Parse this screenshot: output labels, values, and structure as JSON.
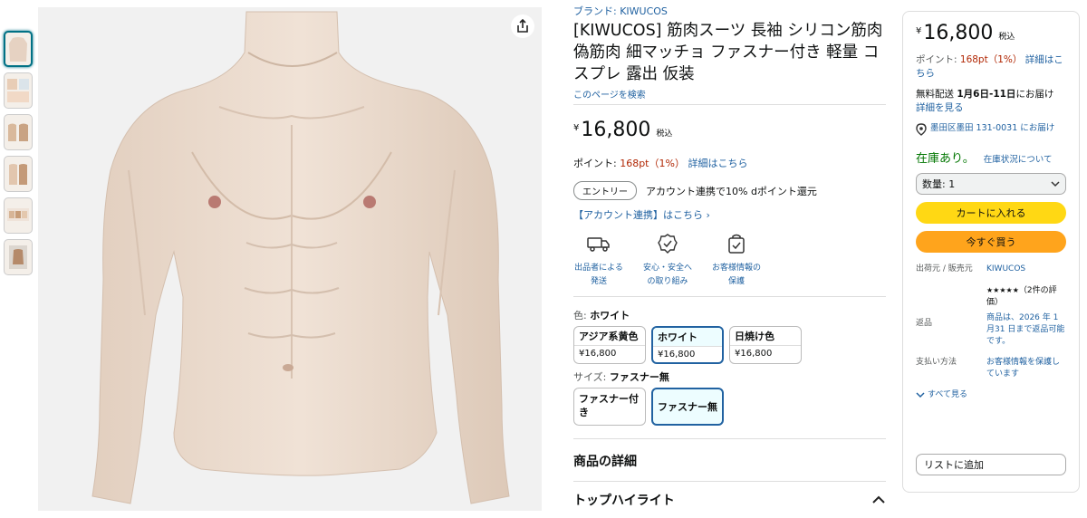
{
  "product": {
    "brand": "ブランド: KIWUCOS",
    "title": "[KIWUCOS] 筋肉スーツ 長袖 シリコン筋肉 偽筋肉 細マッチョ ファスナー付き 軽量 コスプレ 露出 仮装",
    "search_this_page": "このページを検索"
  },
  "price": {
    "yen": "¥",
    "amount": "16,800",
    "tax": "税込",
    "points_label": "ポイント: ",
    "points_value": "168pt（1%）",
    "points_link": "詳細はこちら"
  },
  "entry": {
    "button": "エントリー",
    "text": "アカウント連携で10% dポイント還元",
    "link": "【アカウント連携】はこちら ›"
  },
  "features": [
    {
      "icon": "truck-icon",
      "label": "出品者による発送"
    },
    {
      "icon": "badge-icon",
      "label": "安心・安全への取り組み"
    },
    {
      "icon": "shield-check-icon",
      "label": "お客様情報の保護"
    }
  ],
  "color": {
    "label": "色: ",
    "selected": "ホワイト",
    "options": [
      {
        "name": "アジア系黄色",
        "price": "¥16,800",
        "selected": false
      },
      {
        "name": "ホワイト",
        "price": "¥16,800",
        "selected": true
      },
      {
        "name": "日焼け色",
        "price": "¥16,800",
        "selected": false
      }
    ]
  },
  "size": {
    "label": "サイズ: ",
    "selected": "ファスナー無",
    "options": [
      {
        "name": "ファスナー付き",
        "selected": false
      },
      {
        "name": "ファスナー無",
        "selected": true
      }
    ]
  },
  "sections": {
    "details": "商品の詳細",
    "highlights": "トップハイライト"
  },
  "buybox": {
    "yen": "¥",
    "amount": "16,800",
    "tax": "税込",
    "points_label": "ポイント: ",
    "points_value": "168pt（1%）",
    "points_link": "詳細はこちら",
    "delivery_prefix": "無料配送 ",
    "delivery_date": "1月6日-11日",
    "delivery_suffix": "にお届け",
    "delivery_link": "詳細を見る",
    "location": "墨田区墨田 131-0031 にお届け",
    "stock": "在庫あり。",
    "stock_link": "在庫状況について",
    "quantity": "数量: 1",
    "cart_button": "カートに入れる",
    "buy_button": "今すぐ買う",
    "seller_label": "出荷元 / 販売元",
    "seller_value": "KIWUCOS",
    "rating_stars": "★★★★★",
    "rating_text": "（2件の評価）",
    "returns_label": "返品",
    "returns_value": "商品は、2026 年 1 月31 日まで返品可能です。",
    "payment_label": "支払い方法",
    "payment_value": "お客様情報を保護しています",
    "see_all": "すべて見る",
    "list_button": "リストに追加"
  },
  "colors": {
    "link": "#2162A1",
    "price_red": "#B12704",
    "stock_green": "#007600",
    "cart_yellow": "#FFD814",
    "buy_orange": "#FFA41C"
  }
}
